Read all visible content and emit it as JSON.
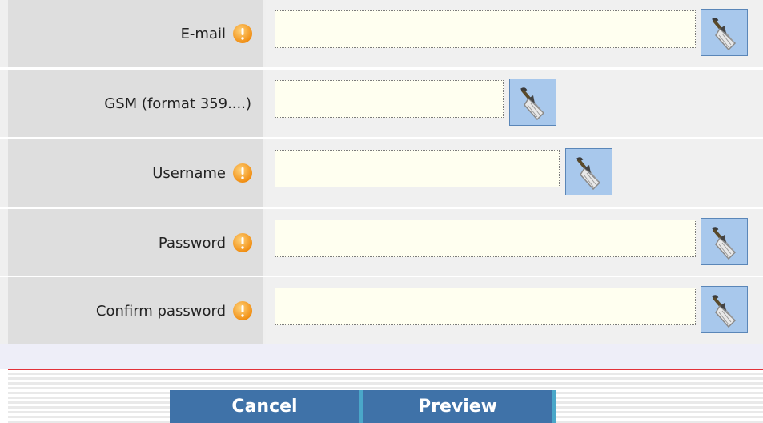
{
  "form": {
    "fields": [
      {
        "label": "E-mail",
        "required": true,
        "value": ""
      },
      {
        "label": "GSM (format 359....)",
        "required": false,
        "value": ""
      },
      {
        "label": "Username",
        "required": true,
        "value": ""
      },
      {
        "label": "Password",
        "required": true,
        "value": ""
      },
      {
        "label": "Confirm password",
        "required": true,
        "value": ""
      }
    ]
  },
  "icons": {
    "required": "exclamation-circle-icon",
    "clear": "broom-icon"
  },
  "colors": {
    "required_icon": "#f5a020",
    "input_background": "#fffff0",
    "clear_button": "#a8c8ec",
    "action_button": "#3f72a8",
    "separator_line": "#e2323a"
  },
  "actions": {
    "cancel_label": "Cancel",
    "preview_label": "Preview"
  }
}
